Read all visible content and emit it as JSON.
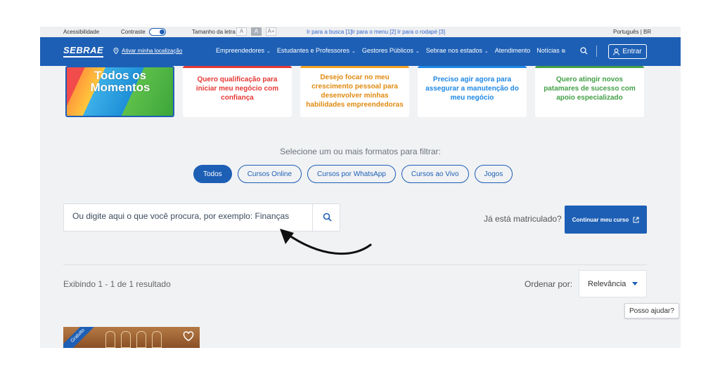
{
  "accessibility_bar": {
    "accessibility": "Acessibilidade",
    "contrast": "Contraste",
    "font_size": "Tamanho da letra",
    "font_small": "A",
    "font_normal": "A",
    "font_large": "A+",
    "skip_search": "Ir para a busca [1]",
    "skip_menu": "Ir para o menu [2]",
    "skip_footer": "Ir para o rodapé [3]",
    "language": "Português | BR"
  },
  "nav": {
    "logo": "SEBRAE",
    "location": "Ativar minha localização",
    "menu": [
      {
        "label": "Empreendedores",
        "icon": "chevron-down-icon"
      },
      {
        "label": "Estudantes e Professores",
        "icon": "chevron-down-icon"
      },
      {
        "label": "Gestores Públicos",
        "icon": "chevron-down-icon"
      },
      {
        "label": "Sebrae nos estados",
        "icon": "chevron-down-icon"
      },
      {
        "label": "Atendimento",
        "icon": ""
      },
      {
        "label": "Notícias",
        "icon": "external-link-icon"
      }
    ],
    "login": "Entrar",
    "brand_color": "#1d5fb5"
  },
  "hero": {
    "line1": "Todos os",
    "line2": "Momentos"
  },
  "cards": [
    {
      "text": "Quero qualificação para iniciar meu negócio com confiança",
      "color": "#e53935"
    },
    {
      "text": "Desejo focar no meu crescimento pessoal para desenvolver minhas habilidades empreendedoras",
      "color": "#f0a020"
    },
    {
      "text": "Preciso agir agora para assegurar a manutenção do meu negócio",
      "color": "#1e88e5"
    },
    {
      "text": "Quero atingir novos patamares de sucesso com apoio especializado",
      "color": "#43a047"
    }
  ],
  "filters": {
    "label": "Selecione um ou mais formatos para filtrar:",
    "chips": [
      "Todos",
      "Cursos Online",
      "Cursos por WhatsApp",
      "Cursos ao Vivo",
      "Jogos"
    ],
    "active": "Todos"
  },
  "search": {
    "placeholder": "Ou digite aqui o que você procura, por exemplo: Finanças"
  },
  "enrolled": {
    "question": "Já está matriculado?",
    "button": "Continuar meu curso"
  },
  "results": {
    "summary": "Exibindo 1 - 1 de 1 resultado",
    "order_label": "Ordenar por:",
    "order_value": "Relevância"
  },
  "help": "Posso ajudar?",
  "course": {
    "badge": "Gratuito"
  }
}
